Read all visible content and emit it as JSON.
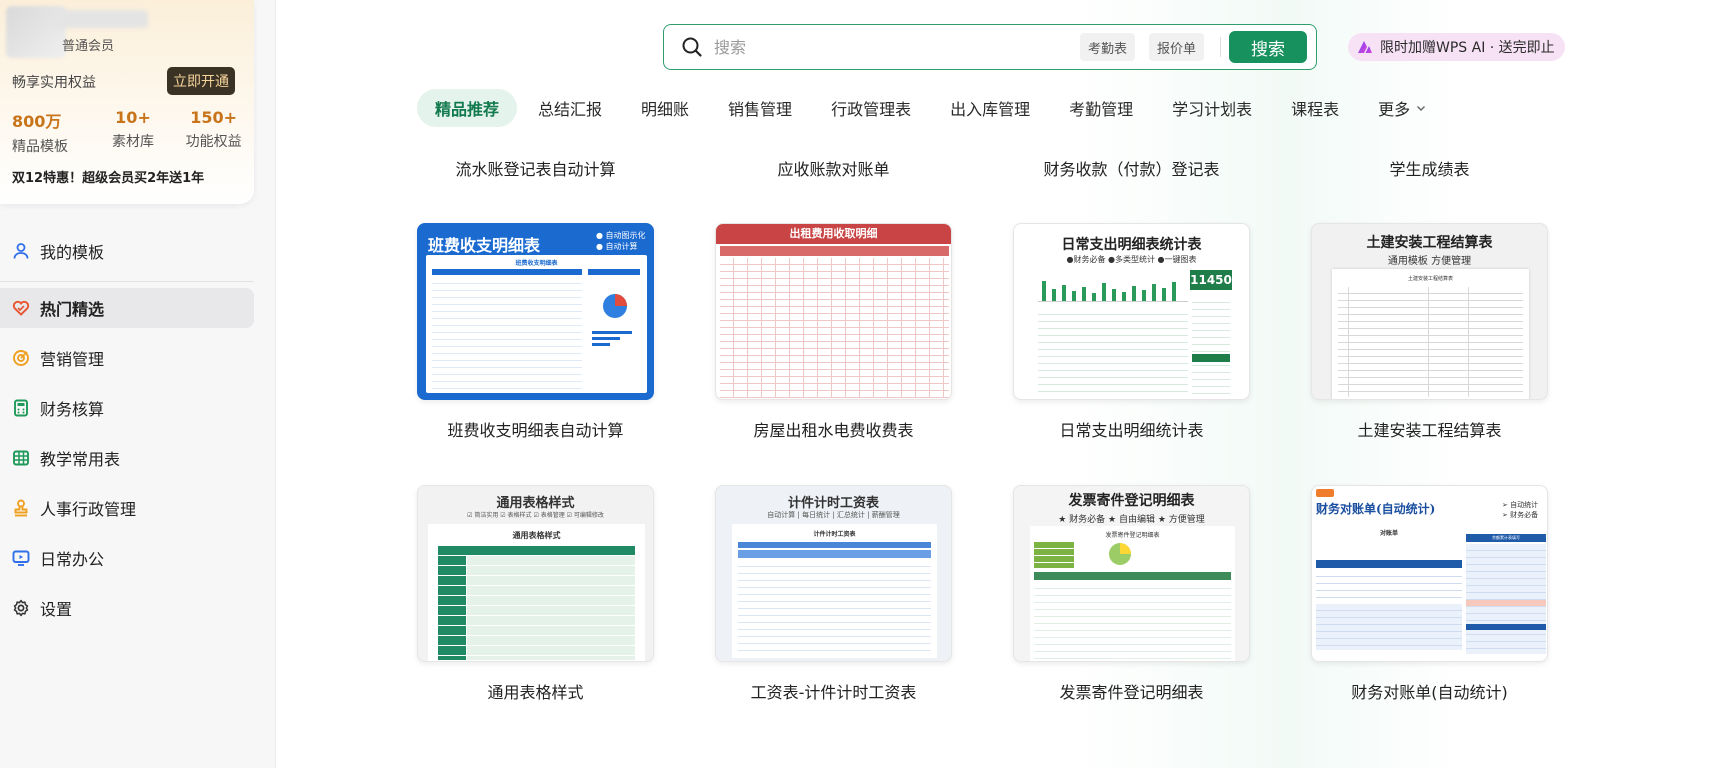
{
  "sidebar": {
    "member_level": "普通会员",
    "benefit_text": "畅享实用权益",
    "open_button": "立即开通",
    "stats": [
      {
        "value": "800万",
        "label": "精品模板"
      },
      {
        "value": "10+",
        "label": "素材库"
      },
      {
        "value": "150+",
        "label": "功能权益"
      }
    ],
    "promo": "双12特惠！超级会员买2年送1年",
    "nav": [
      {
        "label": "我的模板",
        "icon": "user-icon",
        "color": "#2f6fe8"
      },
      {
        "label": "热门精选",
        "icon": "heart-icon",
        "color": "#e8542f",
        "active": true
      },
      {
        "label": "营销管理",
        "icon": "target-icon",
        "color": "#f0a020"
      },
      {
        "label": "财务核算",
        "icon": "calculator-icon",
        "color": "#1f9a5a"
      },
      {
        "label": "教学常用表",
        "icon": "table-icon",
        "color": "#1f9a5a"
      },
      {
        "label": "人事行政管理",
        "icon": "stamp-icon",
        "color": "#f0a020"
      },
      {
        "label": "日常办公",
        "icon": "monitor-icon",
        "color": "#2f6fe8"
      },
      {
        "label": "设置",
        "icon": "gear-icon",
        "color": "#333333"
      }
    ]
  },
  "search": {
    "placeholder": "搜索",
    "chips": [
      "考勤表",
      "报价单"
    ],
    "button": "搜索"
  },
  "ai_promo": "限时加赠WPS AI · 送完即止",
  "tabs": [
    {
      "label": "精品推荐",
      "active": true
    },
    {
      "label": "总结汇报"
    },
    {
      "label": "明细账"
    },
    {
      "label": "销售管理"
    },
    {
      "label": "行政管理表"
    },
    {
      "label": "出入库管理"
    },
    {
      "label": "考勤管理"
    },
    {
      "label": "学习计划表"
    },
    {
      "label": "课程表"
    },
    {
      "label": "更多"
    }
  ],
  "cards": {
    "row0": [
      "流水账登记表自动计算",
      "应收账款对账单",
      "财务收款（付款）登记表",
      "学生成绩表"
    ],
    "row1": [
      "班费收支明细表自动计算",
      "房屋出租水电费收费表",
      "日常支出明细统计表",
      "土建安装工程结算表"
    ],
    "row2": [
      "通用表格样式",
      "工资表-计件计时工资表",
      "发票寄件登记明细表",
      "财务对账单(自动统计)"
    ]
  },
  "thumbs": {
    "t1": {
      "title": "班费收支明细表",
      "tag1": "● 自动图示化",
      "tag2": "● 自动计算",
      "sub": "班费收支明细表"
    },
    "t2": {
      "title": "出租费用收取明细"
    },
    "t3": {
      "title": "日常支出明细表统计表",
      "sub": "●财务必备  ●多类型统计  ●一键图表",
      "big": "11450"
    },
    "t4": {
      "title": "土建安装工程结算表",
      "sub": "通用模板 方便管理",
      "inner": "土建安装工程结算表"
    },
    "t5": {
      "title": "通用表格样式",
      "sub": "☑ 简洁实用   ☑ 表格样式   ☑ 表格管理   ☑ 可编辑修改",
      "inner": "通用表格样式"
    },
    "t6": {
      "title": "计件计时工资表",
      "sub": "自动计算 | 每日统计 | 汇总统计 | 薪酬管理",
      "inner": "计件计时工资表"
    },
    "t7": {
      "title": "发票寄件登记明细表",
      "sub": "★ 财务必备  ★ 自由编辑  ★ 方便管理",
      "inner": "发票寄件登记明细表"
    },
    "t8": {
      "title": "财务对账单(自动统计)",
      "tag1": "➢ 自动统计",
      "tag2": "➢ 财务必备",
      "inner": "对账单",
      "inner2": "余额累计表填写"
    }
  },
  "colors": {
    "accent": "#17915d",
    "active_tab_bg": "#e4f3ec",
    "vip_gold": "#c8741a"
  }
}
